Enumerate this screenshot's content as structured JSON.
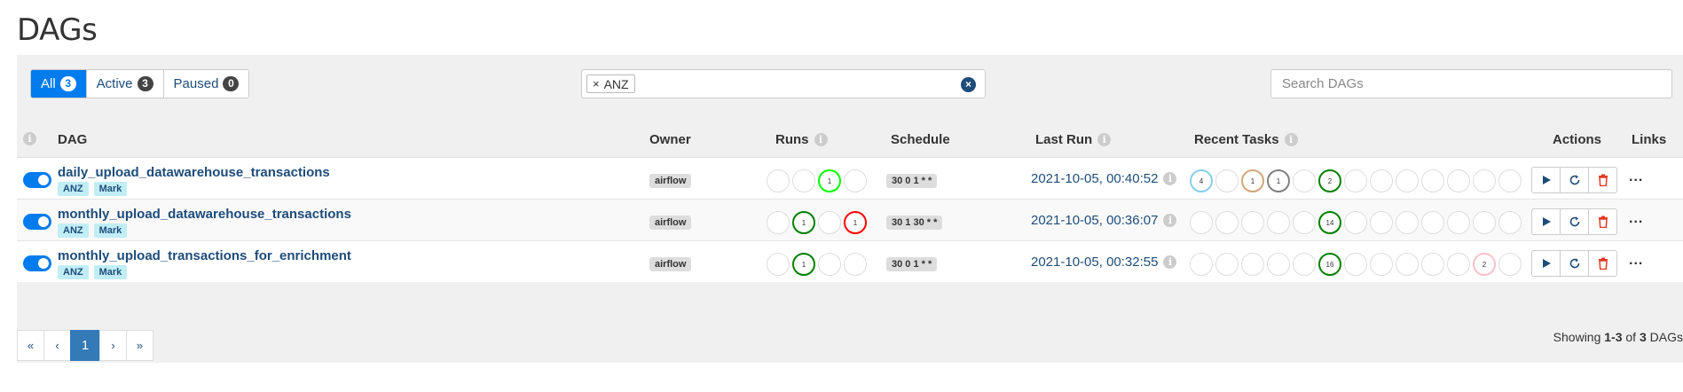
{
  "page_title": "DAGs",
  "filters": {
    "all": {
      "label": "All",
      "count": "3"
    },
    "active": {
      "label": "Active",
      "count": "3"
    },
    "paused": {
      "label": "Paused",
      "count": "0"
    }
  },
  "tag_filter": {
    "remove_glyph": "×",
    "tag": "ANZ",
    "clear_glyph": "×"
  },
  "search": {
    "placeholder": "Search DAGs"
  },
  "headers": {
    "info": "i",
    "dag": "DAG",
    "owner": "Owner",
    "runs": "Runs",
    "schedule": "Schedule",
    "last_run": "Last Run",
    "recent_tasks": "Recent Tasks",
    "actions": "Actions",
    "links": "Links"
  },
  "rows": [
    {
      "name": "daily_upload_datawarehouse_transactions",
      "tags": [
        "ANZ",
        "Mark"
      ],
      "owner": "airflow",
      "schedule": "30 0 1 * *",
      "last_run": "2021-10-05, 00:40:52",
      "runs": [
        {
          "t": "",
          "c": "#ddd"
        },
        {
          "t": "",
          "c": "#ddd"
        },
        {
          "t": "1",
          "c": "#00ff00"
        },
        {
          "t": "",
          "c": "#ddd"
        }
      ],
      "tasks": [
        {
          "t": "4",
          "c": "#87ceeb"
        },
        {
          "t": "",
          "c": "#ddd"
        },
        {
          "t": "1",
          "c": "#d2a679"
        },
        {
          "t": "1",
          "c": "#808080"
        },
        {
          "t": "",
          "c": "#ddd"
        },
        {
          "t": "2",
          "c": "#008000"
        },
        {
          "t": "",
          "c": "#ddd"
        },
        {
          "t": "",
          "c": "#ddd"
        },
        {
          "t": "",
          "c": "#ddd"
        },
        {
          "t": "",
          "c": "#ddd"
        },
        {
          "t": "",
          "c": "#ddd"
        },
        {
          "t": "",
          "c": "#ddd"
        },
        {
          "t": "",
          "c": "#ddd"
        }
      ]
    },
    {
      "name": "monthly_upload_datawarehouse_transactions",
      "tags": [
        "ANZ",
        "Mark"
      ],
      "owner": "airflow",
      "schedule": "30 1 30 * *",
      "last_run": "2021-10-05, 00:36:07",
      "runs": [
        {
          "t": "",
          "c": "#ddd"
        },
        {
          "t": "1",
          "c": "#008000"
        },
        {
          "t": "",
          "c": "#ddd"
        },
        {
          "t": "1",
          "c": "#ff0000"
        }
      ],
      "tasks": [
        {
          "t": "",
          "c": "#ddd"
        },
        {
          "t": "",
          "c": "#ddd"
        },
        {
          "t": "",
          "c": "#ddd"
        },
        {
          "t": "",
          "c": "#ddd"
        },
        {
          "t": "",
          "c": "#ddd"
        },
        {
          "t": "14",
          "c": "#008000"
        },
        {
          "t": "",
          "c": "#ddd"
        },
        {
          "t": "",
          "c": "#ddd"
        },
        {
          "t": "",
          "c": "#ddd"
        },
        {
          "t": "",
          "c": "#ddd"
        },
        {
          "t": "",
          "c": "#ddd"
        },
        {
          "t": "",
          "c": "#ddd"
        },
        {
          "t": "",
          "c": "#ddd"
        }
      ]
    },
    {
      "name": "monthly_upload_transactions_for_enrichment",
      "tags": [
        "ANZ",
        "Mark"
      ],
      "owner": "airflow",
      "schedule": "30 0 1 * *",
      "last_run": "2021-10-05, 00:32:55",
      "runs": [
        {
          "t": "",
          "c": "#ddd"
        },
        {
          "t": "1",
          "c": "#008000"
        },
        {
          "t": "",
          "c": "#ddd"
        },
        {
          "t": "",
          "c": "#ddd"
        }
      ],
      "tasks": [
        {
          "t": "",
          "c": "#ddd"
        },
        {
          "t": "",
          "c": "#ddd"
        },
        {
          "t": "",
          "c": "#ddd"
        },
        {
          "t": "",
          "c": "#ddd"
        },
        {
          "t": "",
          "c": "#ddd"
        },
        {
          "t": "16",
          "c": "#008000"
        },
        {
          "t": "",
          "c": "#ddd"
        },
        {
          "t": "",
          "c": "#ddd"
        },
        {
          "t": "",
          "c": "#ddd"
        },
        {
          "t": "",
          "c": "#ddd"
        },
        {
          "t": "",
          "c": "#ddd"
        },
        {
          "t": "2",
          "c": "#ffc0cb"
        },
        {
          "t": "",
          "c": "#ddd"
        }
      ]
    }
  ],
  "row_links_glyph": "...",
  "pagination": {
    "first": "«",
    "prev": "‹",
    "current": "1",
    "next": "›",
    "last": "»"
  },
  "showing": {
    "prefix": "Showing ",
    "range": "1-3",
    "of": " of ",
    "total": "3",
    "suffix": " DAGs"
  },
  "colors": {
    "accent": "#017cee",
    "link": "#1e4c7a",
    "delete": "#e43921"
  }
}
